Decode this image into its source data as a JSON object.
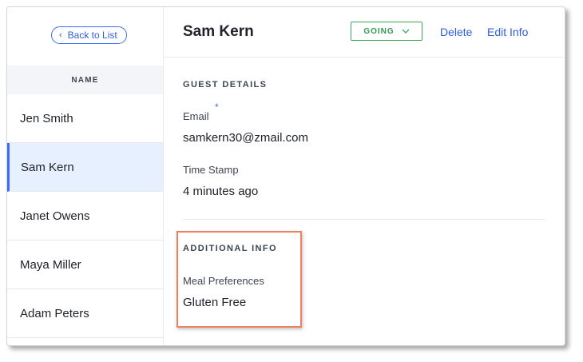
{
  "sidebar": {
    "back_label": "Back to List",
    "column_header": "NAME",
    "guests": [
      "Jen Smith",
      "Sam Kern",
      "Janet Owens",
      "Maya Miller",
      "Adam Peters"
    ],
    "selected_index": 1
  },
  "header": {
    "guest_name": "Sam Kern",
    "status": "GOING",
    "delete_label": "Delete",
    "edit_label": "Edit Info"
  },
  "guest_details": {
    "section_title": "GUEST DETAILS",
    "email_label": "Email",
    "email_required_mark": "*",
    "email_value": "samkern30@zmail.com",
    "timestamp_label": "Time Stamp",
    "timestamp_value": "4 minutes ago"
  },
  "additional_info": {
    "section_title": "ADDITIONAL INFO",
    "meal_label": "Meal Preferences",
    "meal_value": "Gluten Free"
  },
  "icons": {
    "back": "chevron-left-icon",
    "status_dropdown": "chevron-down-icon"
  },
  "colors": {
    "accent_blue": "#3b6ef0",
    "status_green": "#3aa55d",
    "selected_row_bg": "#e7f0fe",
    "highlight_box": "#f07f5e"
  }
}
